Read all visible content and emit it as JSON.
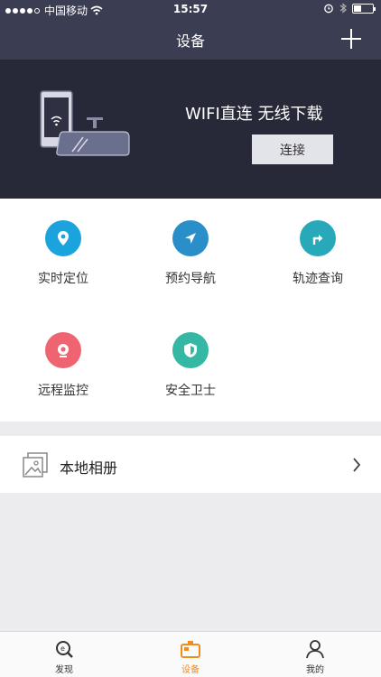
{
  "status_bar": {
    "carrier": "中国移动",
    "time": "15:57"
  },
  "nav": {
    "title": "设备"
  },
  "banner": {
    "title": "WIFI直连 无线下载",
    "connect_label": "连接"
  },
  "features": [
    {
      "label": "实时定位",
      "icon": "location-pin-icon",
      "color": "#1aa3dc"
    },
    {
      "label": "预约导航",
      "icon": "navigation-arrow-icon",
      "color": "#2a8fc9"
    },
    {
      "label": "轨迹查询",
      "icon": "route-turn-icon",
      "color": "#27a9b9"
    },
    {
      "label": "远程监控",
      "icon": "camera-icon",
      "color": "#ee6470"
    },
    {
      "label": "安全卫士",
      "icon": "shield-icon",
      "color": "#35b8a3"
    }
  ],
  "album": {
    "label": "本地相册"
  },
  "tabs": [
    {
      "label": "发现",
      "color": "#333333"
    },
    {
      "label": "设备",
      "color": "#f08c1e"
    },
    {
      "label": "我的",
      "color": "#333333"
    }
  ]
}
